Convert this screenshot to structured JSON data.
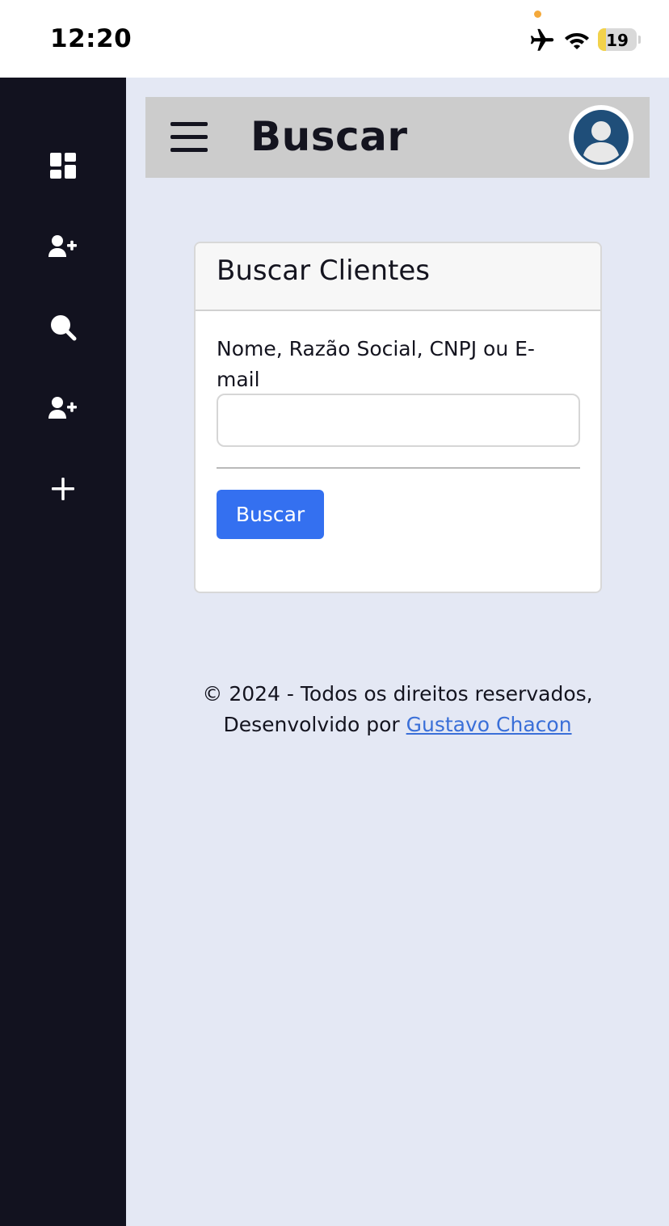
{
  "status_bar": {
    "time": "12:20",
    "battery_level": "19",
    "indicator_color": "#f4a93b",
    "battery_color": "#f2d24b",
    "icons": [
      "airplane-mode-icon",
      "wifi-icon",
      "battery-icon"
    ]
  },
  "sidebar": {
    "items": [
      {
        "name": "dashboard-icon"
      },
      {
        "name": "add-user-icon"
      },
      {
        "name": "search-icon"
      },
      {
        "name": "add-user-icon"
      },
      {
        "name": "plus-icon"
      }
    ]
  },
  "header": {
    "title": "Buscar",
    "menu_icon": "hamburger-menu-icon",
    "avatar_icon": "user-avatar-icon"
  },
  "search_card": {
    "title": "Buscar Clientes",
    "field_label": "Nome, Razão Social, CNPJ ou E-mail",
    "input_value": "",
    "button_label": "Buscar"
  },
  "footer": {
    "copyright": "© 2024 - Todos os direitos reservados,",
    "developed_by": "Desenvolvido por",
    "author_link": "Gustavo Chacon"
  },
  "colors": {
    "sidebar_bg": "#12121f",
    "page_bg": "#e4e8f4",
    "header_bg": "#cccccc",
    "button_bg": "#3470f0",
    "link": "#3a6fd8",
    "avatar": "#1f4e79"
  }
}
